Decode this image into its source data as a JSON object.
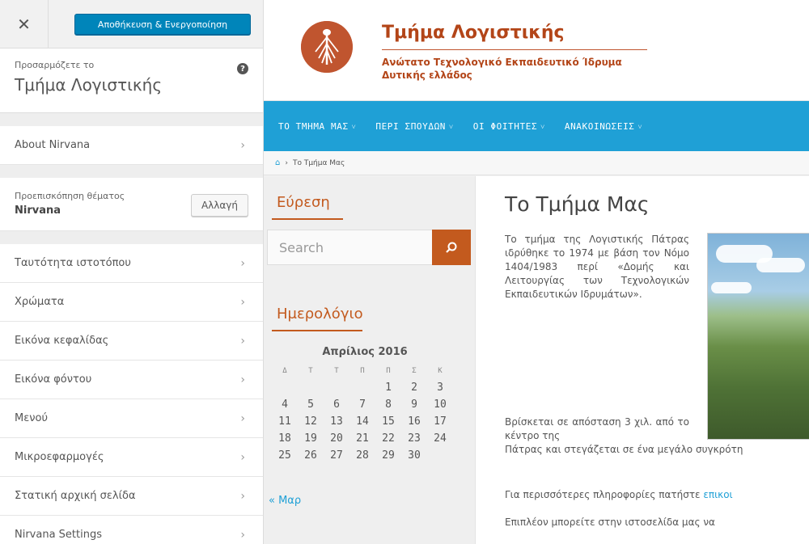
{
  "customizer": {
    "close_glyph": "✕",
    "save_label": "Αποθήκευση & Ενεργοποίηση",
    "info_label": "Προσαρμόζετε το",
    "site_title": "Τμήμα Λογιστικής",
    "help_glyph": "?",
    "about_label": "About Nirvana",
    "theme_preview_label": "Προεπισκόπηση θέματος",
    "theme_name": "Nirvana",
    "change_label": "Αλλαγή",
    "sections": [
      "Ταυτότητα ιστοτόπου",
      "Χρώματα",
      "Εικόνα κεφαλίδας",
      "Εικόνα φόντου",
      "Μενού",
      "Μικροεφαρμογές",
      "Στατική αρχική σελίδα",
      "Nirvana Settings"
    ],
    "chevron": "›"
  },
  "site": {
    "title": "Τμήμα Λογιστικής",
    "subtitle_1": "Ανώτατο Τεχνολογικό Εκπαιδευτικό Ίδρυμα",
    "subtitle_2": "Δυτικής ελλάδος",
    "nav": [
      "ΤΟ ΤΜΗΜΑ ΜΑΣ",
      "ΠΕΡΙ ΣΠΟΥΔΩΝ",
      "ΟΙ ΦΟΙΤΗΤΕΣ",
      "ΑΝΑΚΟΙΝΩΣΕΙΣ"
    ],
    "nav_caret": "˅",
    "breadcrumb_sep": "›",
    "breadcrumb": "Το Τμήμα Μας",
    "search_widget_title": "Εύρεση",
    "search_placeholder": "Search",
    "calendar_widget_title": "Ημερολόγιο",
    "calendar_caption": "Απρίλιος 2016",
    "calendar_days": [
      "Δ",
      "Τ",
      "Τ",
      "Π",
      "Π",
      "Σ",
      "Κ"
    ],
    "calendar_rows": [
      [
        "",
        "",
        "",
        "",
        "1",
        "2",
        "3"
      ],
      [
        "4",
        "5",
        "6",
        "7",
        "8",
        "9",
        "10"
      ],
      [
        "11",
        "12",
        "13",
        "14",
        "15",
        "16",
        "17"
      ],
      [
        "18",
        "19",
        "20",
        "21",
        "22",
        "23",
        "24"
      ],
      [
        "25",
        "26",
        "27",
        "28",
        "29",
        "30",
        ""
      ]
    ],
    "calendar_prev": "« Μαρ",
    "page_title": "Το Τμήμα Μας",
    "para_1": "Το τμήμα της Λογιστικής Πάτρας ιδρύθηκε το 1974 με βάση τον Νόμο 1404/1983 περί «Δομής και Λειτουργίας των Τεχνολογικών Εκπαιδευτικών Ιδρυμάτων».",
    "para_2": "Βρίσκεται σε απόσταση 3 χιλ. από το κέντρο της",
    "para_2b": "Πάτρας και στεγάζεται σε ένα μεγάλο συγκρότη",
    "para_3_text": "Για περισσότερες πληροφορίες πατήστε ",
    "para_3_link": "επικοι",
    "para_4": "Επιπλέον μπορείτε στην ιστοσελίδα μας να"
  },
  "colors": {
    "wp_blue": "#0085ba",
    "site_accent": "#c35a1e",
    "nav_blue": "#1fa0d6"
  }
}
